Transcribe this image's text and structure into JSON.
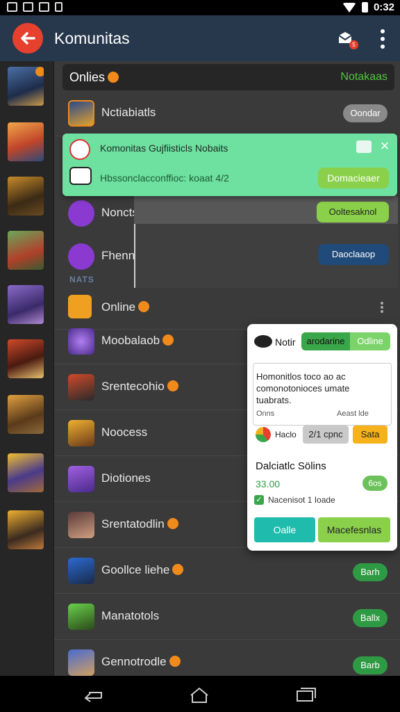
{
  "status_bar": {
    "time": "0:32"
  },
  "app_bar": {
    "title": "Komunitas",
    "badge": "5"
  },
  "online_bar": {
    "label": "Onlies",
    "right_label": "Notakaas"
  },
  "section_label": "NATS",
  "rows": [
    {
      "name": "Nctiabiatls",
      "action": "Oondar"
    },
    {
      "name": "Noncts",
      "action": "Ooltesaknol"
    },
    {
      "name": "Fhennos Odlie",
      "action": "Daoclaaop"
    },
    {
      "name": "Online"
    },
    {
      "name": "Moobalaob"
    },
    {
      "name": "Srentecohio"
    },
    {
      "name": "Noocess"
    },
    {
      "name": "Diotiones"
    },
    {
      "name": "Srentatodlin"
    },
    {
      "name": "Goollce liehe",
      "action": "Barh"
    },
    {
      "name": "Manatotols",
      "action": "Ballx"
    },
    {
      "name": "Gennotrodle",
      "action": "Barb"
    }
  ],
  "toast": {
    "title": "Komonitas Gujfiisticls Nobaits",
    "subtitle": "Hbssonclacconffioc: koaat 4/2",
    "action": "Domacieaer"
  },
  "card": {
    "name": "Notir",
    "tab_active": "arodarine",
    "tab_other": "Odline",
    "message": "Homonitlos toco ao ac comonotonioces umate tuabrats.",
    "meta_left": "Onns",
    "meta_right": "Aeast lde",
    "rate_label": "Haclo",
    "rate_value": "2/1 cpnc",
    "rate_tag": "Sata",
    "heading": "Dalciatlc Sölins",
    "price": "33.00",
    "price_badge": "6os",
    "note": "Nacenisot 1 Ioade",
    "btn_left": "Oalle",
    "btn_right": "Macefesnlas"
  },
  "colors": {
    "accent": "#e5412e",
    "appbar": "#27384d",
    "toast": "#6ee0a0",
    "green": "#2f9a44"
  }
}
